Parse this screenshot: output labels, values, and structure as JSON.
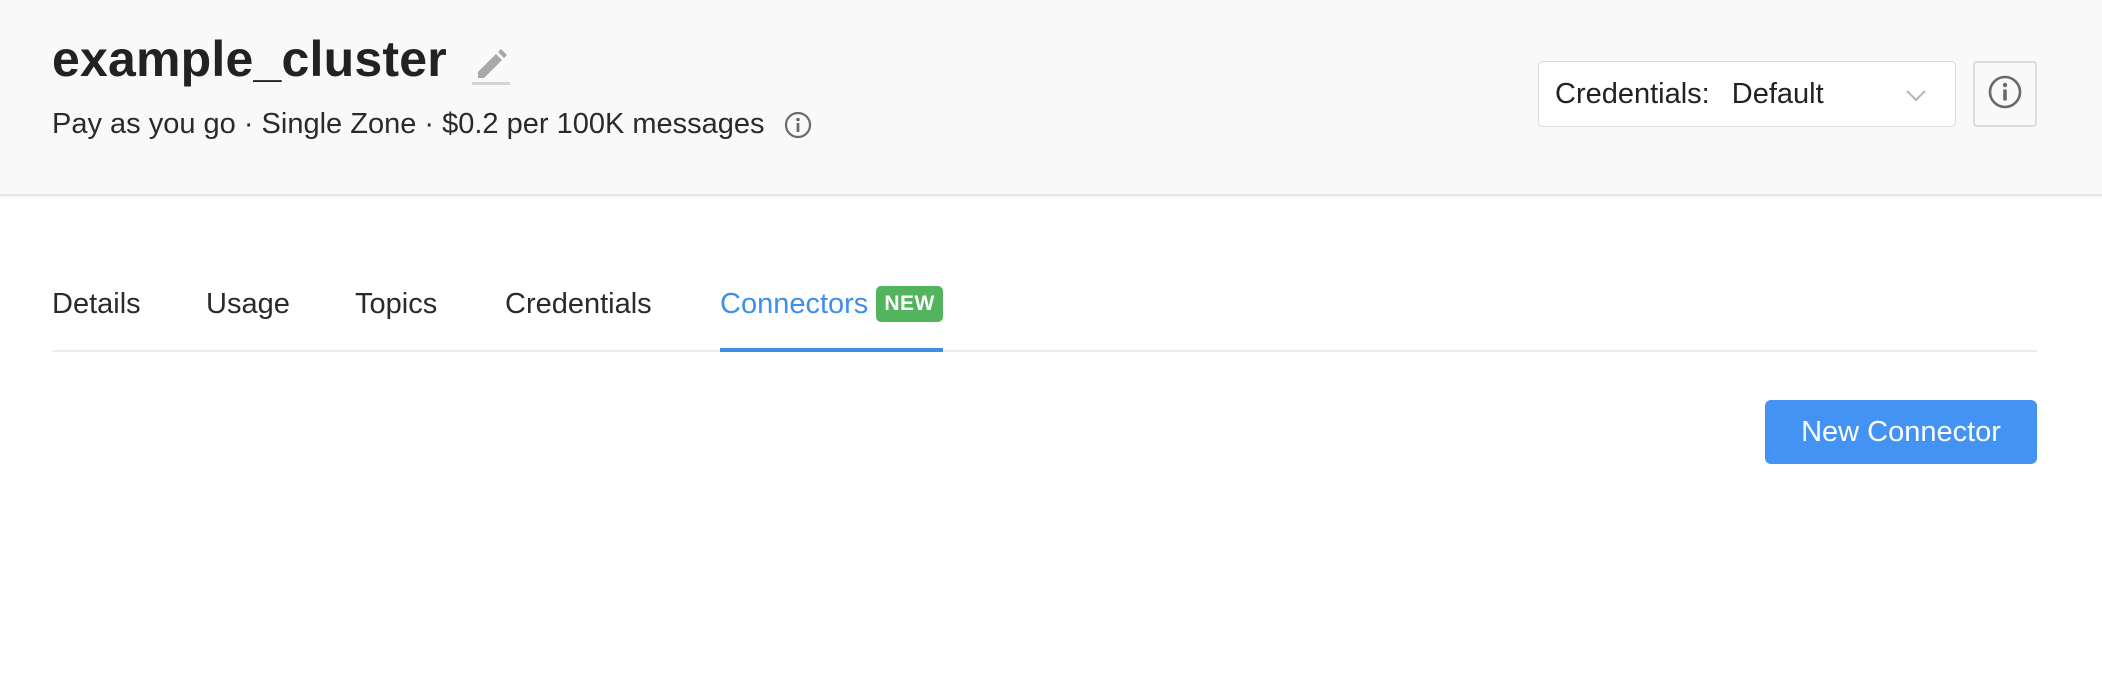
{
  "cluster": {
    "name": "example_cluster",
    "plan_summary": "Pay as you go · Single Zone · $0.2 per 100K messages"
  },
  "credentials": {
    "label": "Credentials:",
    "selected": "Default"
  },
  "tabs": [
    {
      "label": "Details"
    },
    {
      "label": "Usage"
    },
    {
      "label": "Topics"
    },
    {
      "label": "Credentials"
    },
    {
      "label": "Connectors",
      "badge": "NEW",
      "active": true
    }
  ],
  "actions": {
    "new_connector_label": "New Connector"
  },
  "colors": {
    "accent": "#3d8fea",
    "button": "#4293f3",
    "badge": "#52b45d"
  },
  "icons": {
    "edit": "pencil-icon",
    "plan_info": "info-icon",
    "select_chevron": "chevron-down-icon",
    "info_button": "info-icon"
  }
}
